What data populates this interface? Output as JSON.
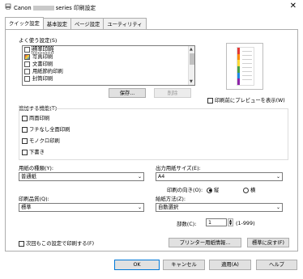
{
  "window": {
    "title_prefix": "Canon",
    "title_suffix": "series 印刷設定",
    "close_glyph": "✕"
  },
  "tabs": [
    "クイック設定",
    "基本設定",
    "ページ設定",
    "ユーティリティ"
  ],
  "favorites": {
    "label": "よく使う設定(S)",
    "items": [
      "標準印刷",
      "写真印刷",
      "文書印刷",
      "用紙節約印刷",
      "封筒印刷"
    ],
    "save_label": "保存...",
    "delete_label": "削除"
  },
  "preview_checkbox_label": "印刷前にプレビューを表示(W)",
  "additional_features": {
    "label": "追加する機能(T)",
    "items": [
      "両面印刷",
      "フチなし全面印刷",
      "モノクロ印刷",
      "下書き"
    ]
  },
  "media_type": {
    "label": "用紙の種類(Y):",
    "value": "普通紙"
  },
  "print_quality": {
    "label": "印刷品質(Q):",
    "value": "標準"
  },
  "output_paper_size": {
    "label": "出力用紙サイズ(E):",
    "value": "A4"
  },
  "orientation": {
    "label": "印刷の向き(O):",
    "portrait_label": "縦",
    "landscape_label": "横",
    "selected": "portrait"
  },
  "paper_source": {
    "label": "給紙方法(Z):",
    "value": "自動選択"
  },
  "copies": {
    "label": "部数(C):",
    "value": "1",
    "range": "(1-999)"
  },
  "always_print_label": "次回もこの設定で印刷する(F)",
  "printer_paper_info_label": "プリンター用紙情報...",
  "defaults_label": "標準に戻す(F)",
  "buttons": {
    "ok": "OK",
    "cancel": "キャンセル",
    "apply": "適用(A)",
    "help": "ヘルプ"
  },
  "colors": {
    "preview_stripes": [
      "#e53935",
      "#fb8c00",
      "#fdd835",
      "#43a047",
      "#1e88e5",
      "#8e24aa"
    ]
  }
}
